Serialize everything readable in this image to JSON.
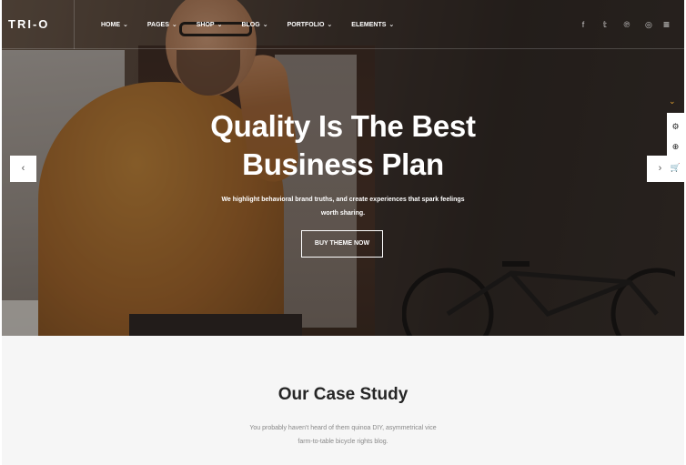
{
  "brand": {
    "logo": "TRI-O"
  },
  "nav": {
    "items": [
      {
        "label": "HOME"
      },
      {
        "label": "PAGES"
      },
      {
        "label": "SHOP"
      },
      {
        "label": "BLOG"
      },
      {
        "label": "PORTFOLIO"
      },
      {
        "label": "ELEMENTS"
      }
    ],
    "chevron": "⌄"
  },
  "socials": {
    "facebook": "f",
    "twitter": "𝕥",
    "pinterest": "℗",
    "instagram": "◎",
    "menu": "≡"
  },
  "hero": {
    "title_line1": "Quality Is The Best",
    "title_line2": "Business Plan",
    "subtitle": "We highlight behavioral brand truths, and create experiences that spark feelings worth sharing.",
    "button": "BUY THEME NOW",
    "prev_arrow": "‹",
    "next_arrow": "›"
  },
  "side_panel": {
    "chevron": "⌄",
    "tools": [
      {
        "icon": "gear-icon",
        "glyph": "⚙"
      },
      {
        "icon": "lifebuoy-icon",
        "glyph": "⊕"
      },
      {
        "icon": "cart-icon",
        "glyph": "🛒"
      }
    ]
  },
  "case_study": {
    "title": "Our Case Study",
    "text_line1": "You probably haven't heard of them quinoa DIY, asymmetrical vice",
    "text_line2": "farm-to-table bicycle rights blog."
  },
  "colors": {
    "accent": "#e0a030",
    "text_dark": "#262626",
    "text_muted": "#888888",
    "section_bg": "#f6f6f6"
  }
}
